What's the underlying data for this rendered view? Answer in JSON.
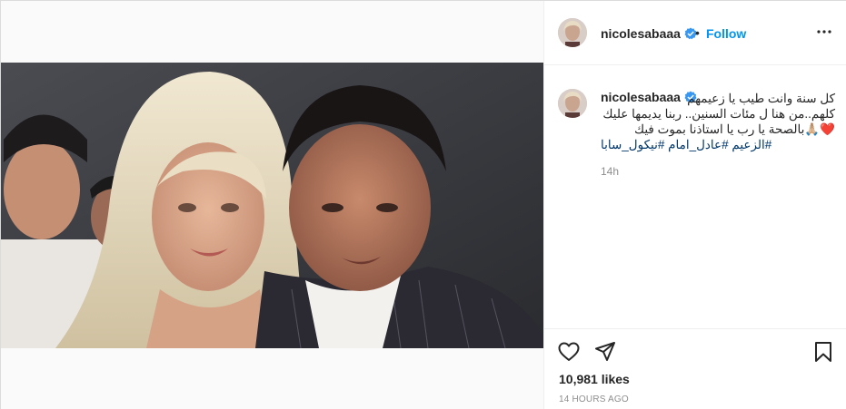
{
  "post": {
    "author": {
      "username": "nicolesabaaa",
      "verified": true,
      "avatar": "profile-photo"
    },
    "header": {
      "separator": "•",
      "follow_label": "Follow",
      "more_icon": "ellipsis-icon"
    },
    "photo": {
      "kind": "photo",
      "description_icon": "post-image"
    },
    "caption": {
      "username": "nicolesabaaa",
      "lines": [
        "كل سنة وانت طيب يا زعيمهم",
        "كلهم..من هنا ل مئات السنين.. ربنا يديمها عليك",
        "❤️🙏🏼بالصحة يا رب يا استاذنا بموت فيك"
      ],
      "hashtags": "#الزعيم #عادل_امام #نيكول_سابا",
      "timestamp": "14h"
    },
    "actions": {
      "like_icon": "heart-icon",
      "share_icon": "send-icon",
      "save_icon": "bookmark-icon"
    },
    "likes_text": "10,981 likes",
    "posted_ago": "14 HOURS AGO"
  },
  "colors": {
    "link": "#0095f6",
    "hashtag": "#00376b",
    "verified": "#3897f0",
    "muted": "#8e8e8e",
    "border": "#dbdbdb"
  }
}
